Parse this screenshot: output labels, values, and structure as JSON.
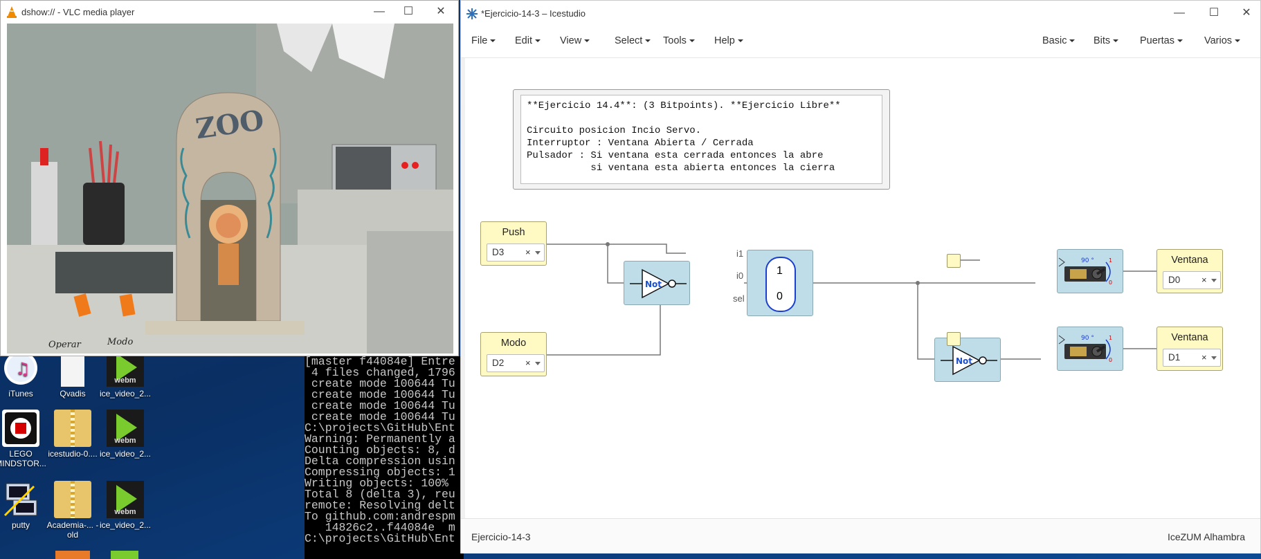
{
  "desktop": {
    "icons": [
      {
        "label": "iTunes",
        "kind": "itunes"
      },
      {
        "label": "Qvadis",
        "kind": "doc"
      },
      {
        "label": "ice_video_2...",
        "kind": "webm"
      },
      {
        "label": "LEGO MINDSTOR...",
        "kind": "lego"
      },
      {
        "label": "icestudio-0....",
        "kind": "zip"
      },
      {
        "label": "ice_video_2...",
        "kind": "webm"
      },
      {
        "label": "putty",
        "kind": "putty"
      },
      {
        "label": "Academia-... - old",
        "kind": "zip"
      },
      {
        "label": "ice_video_2...",
        "kind": "webm"
      }
    ],
    "webm_badge": "webm"
  },
  "console": {
    "lines": [
      "[master f44084e] Entre",
      " 4 files changed, 1796",
      " create mode 100644 Tu",
      " create mode 100644 Tu",
      " create mode 100644 Tu",
      " create mode 100644 Tu",
      "C:\\projects\\GitHub\\Ent",
      "Warning: Permanently a",
      "Counting objects: 8, d",
      "Delta compression usin",
      "Compressing objects: 1",
      "Writing objects: 100%",
      "Total 8 (delta 3), reu",
      "remote: Resolving delt",
      "To github.com:andrespm",
      "   14826c2..f44084e  m",
      "C:\\projects\\GitHub\\Ent"
    ]
  },
  "vlc": {
    "title": "dshow:// - VLC media player",
    "video": {
      "zoo_sign": "ZOO",
      "label_left": "Operar",
      "label_right": "Modo"
    }
  },
  "icestudio": {
    "title": "*Ejercicio-14-3 – Icestudio",
    "menu_left": [
      "File",
      "Edit",
      "View",
      "Select",
      "Tools",
      "Help"
    ],
    "menu_right": [
      "Basic",
      "Bits",
      "Puertas",
      "Varios"
    ],
    "comment_lines": [
      "**Ejercicio 14.4**: (3 Bitpoints). **Ejercicio Libre**",
      "",
      "Circuito posicion Incio Servo.",
      "Interruptor : Ventana Abierta / Cerrada",
      "Pulsador : Si ventana esta cerrada entonces la abre",
      "           si ventana esta abierta entonces la cierra"
    ],
    "inputs": [
      {
        "name": "Push",
        "pin": "D3"
      },
      {
        "name": "Modo",
        "pin": "D2"
      }
    ],
    "outputs": [
      {
        "name": "Ventana",
        "pin": "D0"
      },
      {
        "name": "Ventana",
        "pin": "D1"
      }
    ],
    "not_label": "Not",
    "mux": {
      "in1": "i1",
      "in0": "i0",
      "sel": "sel",
      "top": "1",
      "bottom": "0"
    },
    "servo": {
      "angle": "90 °",
      "one": "1",
      "zero": "0"
    },
    "status_left": "Ejercicio-14-3",
    "status_right": "IceZUM Alhambra",
    "colors": {
      "block_blue": "#bfdde8",
      "port_yellow": "#fff9c4",
      "wire": "#777777"
    }
  }
}
